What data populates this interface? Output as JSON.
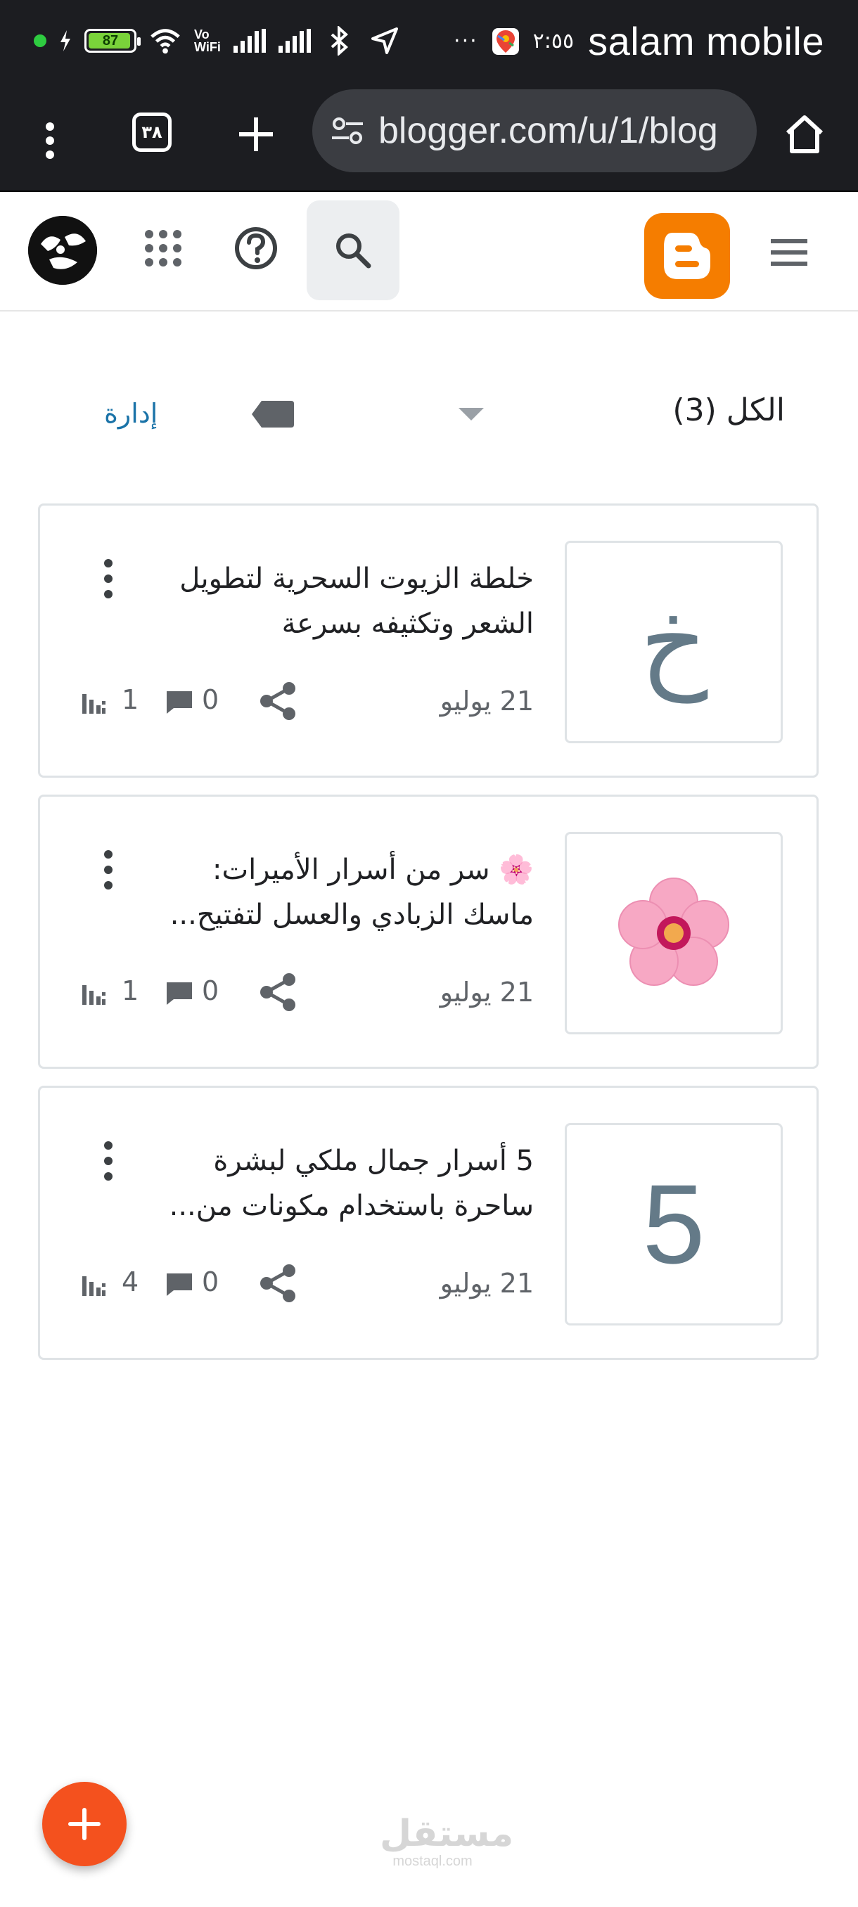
{
  "status_bar": {
    "battery_level": "87",
    "vowifi": "Vo\nWiFi",
    "clock": "٢:٥٥",
    "more_dots": "···",
    "carrier": "salam mobile"
  },
  "browser": {
    "tab_count": "٣٨",
    "url": "blogger.com/u/1/blog"
  },
  "header": {
    "brand_color": "#f57d00"
  },
  "filter": {
    "all_label": "الكل (3)",
    "manage_label": "إدارة"
  },
  "posts": [
    {
      "title": "خلطة الزيوت السحرية لتطويل الشعر وتكثيفه بسرعة",
      "thumb_text": "خ",
      "date": "21 يوليو",
      "comments": "0",
      "views": "1"
    },
    {
      "title": "🌸 سر من أسرار الأميرات: ماسك الزبادي والعسل لتفتيح...",
      "thumb_icon": "cherry-blossom-icon",
      "date": "21 يوليو",
      "comments": "0",
      "views": "1"
    },
    {
      "title": "5 أسرار جمال ملكي لبشرة ساحرة باستخدام مكونات من...",
      "thumb_text": "5",
      "date": "21 يوليو",
      "comments": "0",
      "views": "4"
    }
  ],
  "fab": {
    "label": "+",
    "color": "#f4511e"
  },
  "watermark": {
    "arabic": "مستقل",
    "latin": "mostaql.com"
  }
}
